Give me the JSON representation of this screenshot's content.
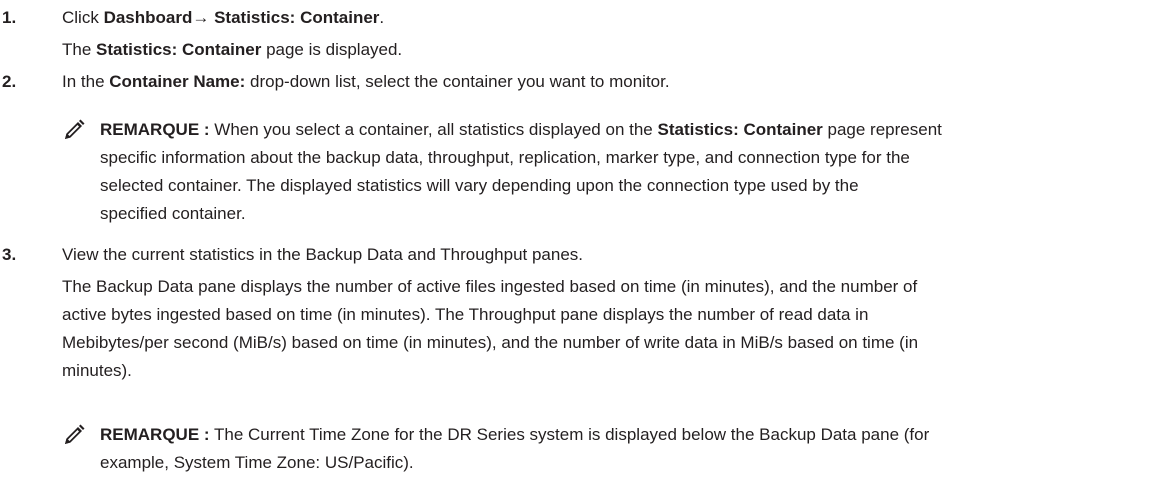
{
  "steps": [
    {
      "number": "1.",
      "line1": {
        "pre": "Click ",
        "b1": "Dashboard",
        "mid": "→ ",
        "b2": "Statistics: Container",
        "post": "."
      },
      "line2": {
        "pre": "The ",
        "b1": "Statistics: Container",
        "post": " page is displayed."
      }
    },
    {
      "number": "2.",
      "line1": {
        "pre": "In the ",
        "b1": "Container Name:",
        "post": " drop-down list, select the container you want to monitor."
      },
      "note": {
        "label": "REMARQUE :",
        "line1_pre": " When you select a container, all statistics displayed on the ",
        "line1_bold": "Statistics: Container",
        "line1_post": " page represent",
        "line2": "specific information about the backup data, throughput, replication, marker type, and connection type for the",
        "line3": "selected container. The displayed statistics will vary depending upon the connection type used by the",
        "line4": "specified container."
      }
    },
    {
      "number": "3.",
      "line1": "View the current statistics in the Backup Data and Throughput panes.",
      "para": [
        "The Backup Data pane displays the number of active files ingested based on time (in minutes), and the number of",
        "active bytes ingested based on time (in minutes). The Throughput pane displays the number of read data in",
        "Mebibytes/per second (MiB/s) based on time (in minutes), and the number of write data in MiB/s based on time (in",
        "minutes)."
      ],
      "note": {
        "label": "REMARQUE :",
        "line1": " The Current Time Zone for the DR Series system is displayed below the Backup Data pane (for",
        "line2": "example, System Time Zone: US/Pacific)."
      }
    }
  ],
  "icons": {
    "note_icon": "pencil-note-icon"
  },
  "colors": {
    "text": "#231f20"
  }
}
